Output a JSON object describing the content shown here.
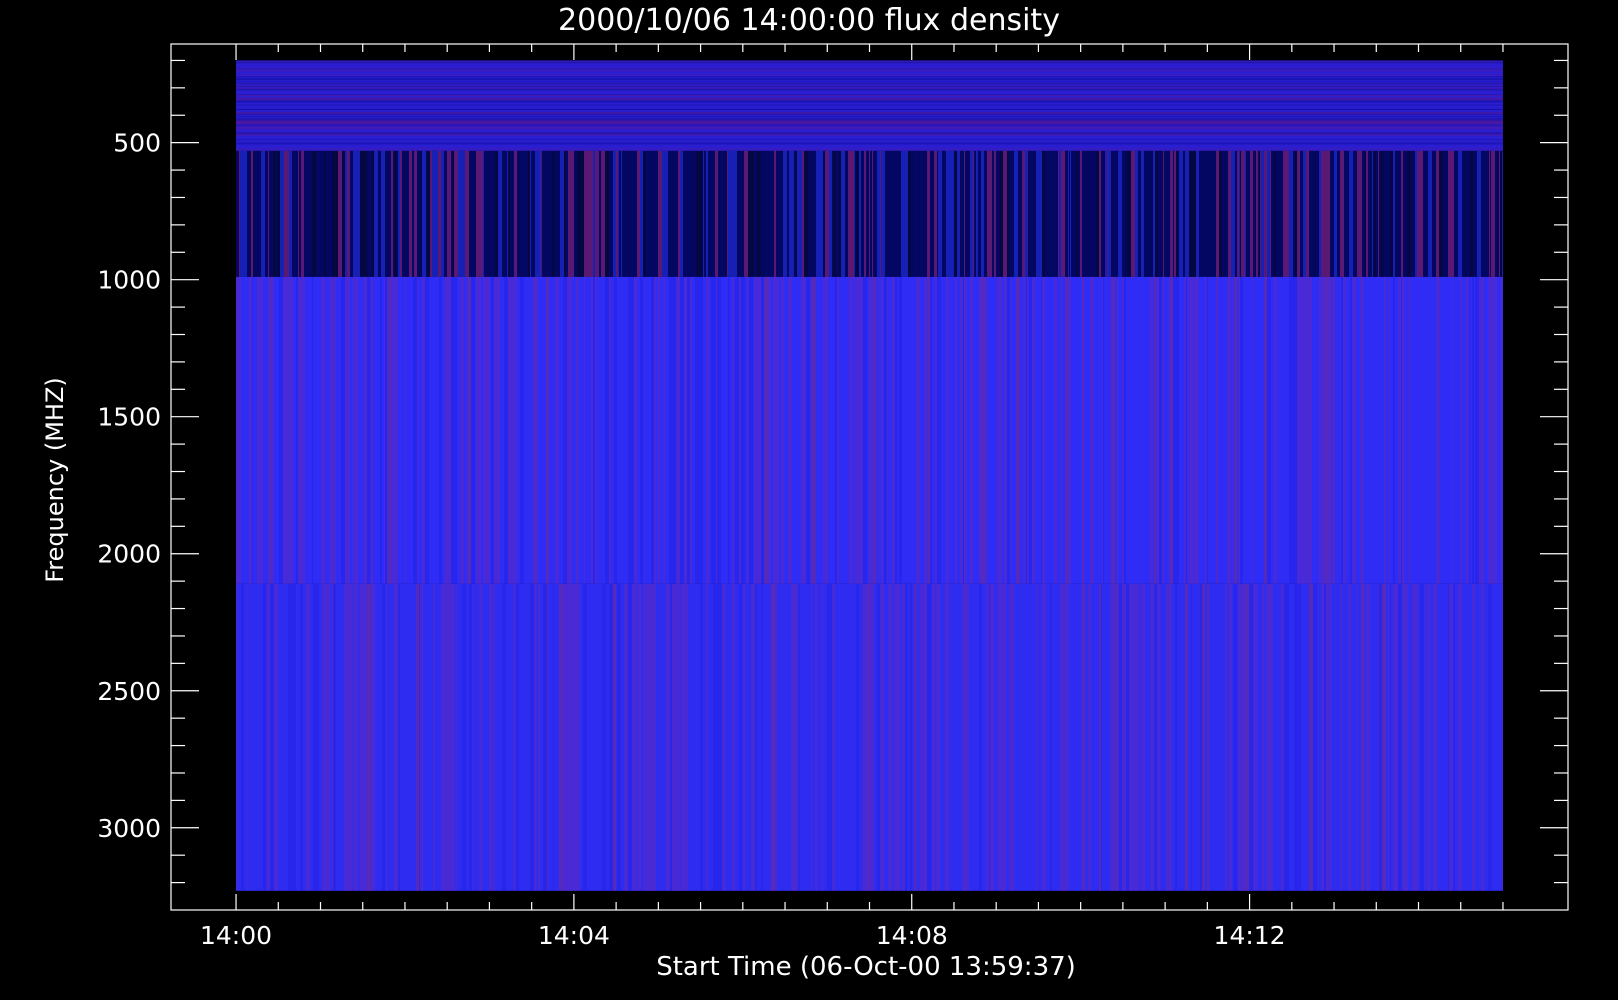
{
  "chart_data": {
    "type": "heatmap",
    "title": "2000/10/06 14:00:00 flux density",
    "xlabel": "Start Time (06-Oct-00 13:59:37)",
    "ylabel": "Frequency (MHZ)",
    "x_ticks": [
      "14:00",
      "14:04",
      "14:08",
      "14:12"
    ],
    "x_tick_minutes": [
      0,
      4,
      8,
      12
    ],
    "y_ticks": [
      "500",
      "1000",
      "1500",
      "2000",
      "2500",
      "3000"
    ],
    "y_tick_values": [
      500,
      1000,
      1500,
      2000,
      2500,
      3000
    ],
    "xlim_minutes": [
      -0.77,
      15.77
    ],
    "data_x_range_minutes": [
      0,
      15
    ],
    "ylim": [
      3300,
      140
    ],
    "data_freq_range": [
      200,
      3230
    ],
    "bands": [
      {
        "name": "band-1",
        "freq_range": [
          200,
          530
        ],
        "base_color": "#2a1ed0",
        "texture": "noise"
      },
      {
        "name": "band-2",
        "freq_range": [
          530,
          990
        ],
        "base_color": "#101a8a",
        "texture": "stripes-dark"
      },
      {
        "name": "band-3",
        "freq_range": [
          990,
          2110
        ],
        "base_color": "#2f2cf6",
        "texture": "stripes"
      },
      {
        "name": "band-4",
        "freq_range": [
          2110,
          3230
        ],
        "base_color": "#2f2cf2",
        "texture": "stripes"
      }
    ],
    "colors": {
      "background": "#000000",
      "axis": "#ffffff",
      "high_flux": "#b0204a",
      "low_flux": "#00003a"
    }
  }
}
